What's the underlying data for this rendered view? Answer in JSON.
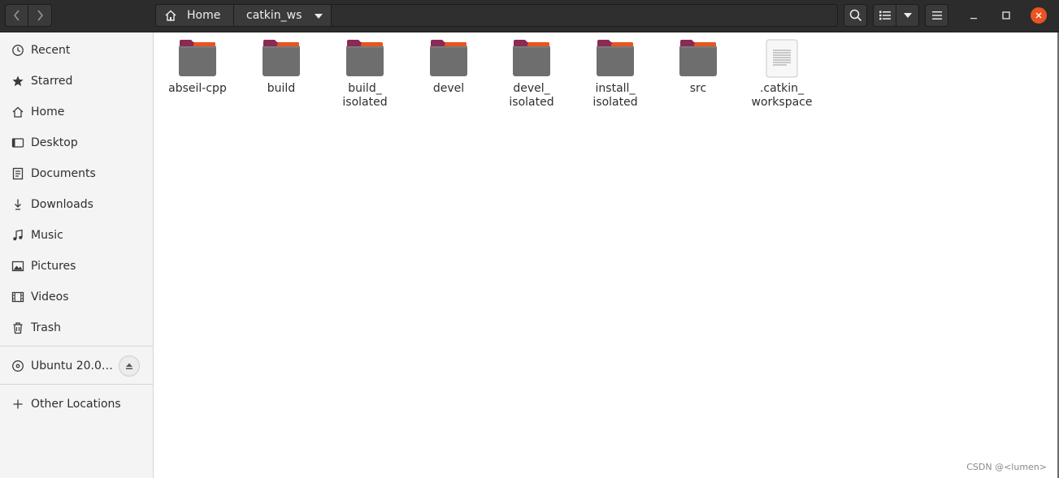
{
  "colors": {
    "accent": "#e95420",
    "folder_body": "#6e6e6e",
    "folder_tab": "#8a2a55",
    "headerbar": "#2c2c2c"
  },
  "header": {
    "back_icon": "chevron-left-icon",
    "forward_icon": "chevron-right-icon",
    "path": [
      {
        "label": "Home",
        "icon": "home-icon"
      },
      {
        "label": "catkin_ws"
      }
    ],
    "search_icon": "search-icon",
    "view_icon": "list-view-icon",
    "menu_icon": "hamburger-menu-icon",
    "window_controls": [
      "minimize-icon",
      "maximize-icon",
      "close-icon"
    ]
  },
  "sidebar": {
    "items": [
      {
        "label": "Recent",
        "icon": "clock-icon"
      },
      {
        "label": "Starred",
        "icon": "star-icon"
      },
      {
        "label": "Home",
        "icon": "home-icon"
      },
      {
        "label": "Desktop",
        "icon": "desktop-icon"
      },
      {
        "label": "Documents",
        "icon": "document-icon"
      },
      {
        "label": "Downloads",
        "icon": "download-icon"
      },
      {
        "label": "Music",
        "icon": "music-icon"
      },
      {
        "label": "Pictures",
        "icon": "picture-icon"
      },
      {
        "label": "Videos",
        "icon": "video-icon"
      },
      {
        "label": "Trash",
        "icon": "trash-icon"
      }
    ],
    "devices": [
      {
        "label": "Ubuntu 20.0…",
        "icon": "disc-icon",
        "action_icon": "eject-icon"
      }
    ],
    "other": {
      "label": "Other Locations",
      "icon": "plus-icon"
    }
  },
  "files": [
    {
      "name": "abseil-cpp",
      "type": "folder"
    },
    {
      "name": "build",
      "type": "folder"
    },
    {
      "name": "build_\nisolated",
      "type": "folder"
    },
    {
      "name": "devel",
      "type": "folder"
    },
    {
      "name": "devel_\nisolated",
      "type": "folder"
    },
    {
      "name": "install_\nisolated",
      "type": "folder"
    },
    {
      "name": "src",
      "type": "folder"
    },
    {
      "name": ".catkin_\nworkspace",
      "type": "text-file"
    }
  ],
  "watermark": "CSDN @<lumen>"
}
